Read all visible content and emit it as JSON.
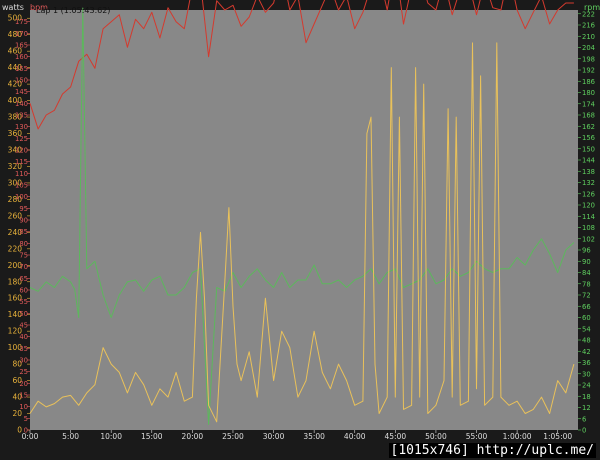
{
  "chart_data": {
    "type": "line",
    "title": "Lap 1 (1:05:43.62)",
    "x_ticks": [
      "0:00",
      "5:00",
      "10:00",
      "15:00",
      "20:00",
      "25:00",
      "30:00",
      "35:00",
      "40:00",
      "45:00",
      "50:00",
      "55:00",
      "1:00:00",
      "1:05:00"
    ],
    "xlim_minutes": [
      0,
      67.5
    ],
    "grid": false,
    "axes": [
      {
        "id": "watts",
        "label": "watts",
        "side": "left-outer",
        "color": "#e9b33b",
        "ylim": [
          0,
          510
        ],
        "ticks": [
          0,
          20,
          40,
          60,
          80,
          100,
          120,
          140,
          160,
          180,
          200,
          220,
          240,
          260,
          280,
          300,
          320,
          340,
          360,
          380,
          400,
          420,
          440,
          460,
          480,
          500
        ]
      },
      {
        "id": "bpm",
        "label": "bpm",
        "side": "left-inner",
        "color": "#e05a5a",
        "ylim": [
          0,
          180
        ],
        "ticks": [
          0,
          5,
          10,
          15,
          20,
          25,
          30,
          35,
          40,
          45,
          50,
          55,
          60,
          65,
          70,
          75,
          80,
          85,
          90,
          95,
          100,
          105,
          110,
          115,
          120,
          125,
          130,
          135,
          140,
          145,
          150,
          155,
          160,
          165,
          170,
          175
        ]
      },
      {
        "id": "rpm",
        "label": "rpm",
        "side": "right",
        "color": "#5fcf5f",
        "ylim": [
          0,
          224
        ],
        "ticks": [
          0,
          6,
          12,
          18,
          24,
          30,
          36,
          42,
          48,
          54,
          60,
          66,
          72,
          78,
          84,
          90,
          96,
          102,
          108,
          114,
          120,
          126,
          132,
          138,
          144,
          150,
          156,
          162,
          168,
          174,
          180,
          186,
          192,
          198,
          204,
          210,
          216,
          222
        ]
      }
    ],
    "series": [
      {
        "axis": "bpm",
        "color": "#d43a2e",
        "x": [
          0,
          1,
          2,
          3,
          4,
          5,
          6,
          7,
          8,
          9,
          10,
          11,
          12,
          13,
          14,
          15,
          16,
          17,
          18,
          19,
          20,
          21,
          22,
          23,
          24,
          25,
          26,
          27,
          28,
          29,
          30,
          31,
          32,
          33,
          34,
          35,
          36,
          37,
          38,
          39,
          40,
          41,
          42,
          43,
          44,
          45,
          46,
          47,
          48,
          49,
          50,
          51,
          52,
          53,
          54,
          55,
          56,
          57,
          58,
          59,
          60,
          61,
          62,
          63,
          64,
          65,
          66,
          67
        ],
        "y": [
          140,
          129,
          135,
          137,
          144,
          147,
          158,
          161,
          155,
          172,
          175,
          178,
          164,
          176,
          172,
          179,
          168,
          181,
          175,
          172,
          190,
          192,
          160,
          184,
          180,
          182,
          173,
          177,
          186,
          179,
          183,
          197,
          180,
          186,
          166,
          174,
          182,
          190,
          180,
          186,
          172,
          179,
          190,
          195,
          180,
          200,
          174,
          190,
          196,
          183,
          180,
          193,
          178,
          189,
          192,
          178,
          192,
          181,
          180,
          196,
          180,
          172,
          179,
          186,
          174,
          180,
          183,
          183
        ]
      },
      {
        "axis": "rpm",
        "color": "#5cb85c",
        "x": [
          0,
          1,
          2,
          3,
          4,
          5,
          5.5,
          6,
          6.5,
          7,
          8,
          9,
          10,
          11,
          12,
          13,
          14,
          15,
          16,
          17,
          18,
          19,
          20,
          21,
          22,
          23,
          24,
          25,
          26,
          27,
          28,
          29,
          30,
          31,
          32,
          33,
          34,
          35,
          36,
          37,
          38,
          39,
          40,
          41,
          42,
          43,
          44,
          45,
          46,
          47,
          48,
          49,
          50,
          51,
          52,
          53,
          54,
          55,
          56,
          57,
          58,
          59,
          60,
          61,
          62,
          63,
          64,
          65,
          66,
          67
        ],
        "y": [
          76,
          74,
          79,
          76,
          82,
          79,
          75,
          60,
          225,
          86,
          90,
          72,
          60,
          72,
          79,
          80,
          74,
          80,
          82,
          72,
          72,
          76,
          84,
          86,
          3,
          76,
          74,
          84,
          76,
          82,
          86,
          80,
          76,
          84,
          76,
          80,
          80,
          88,
          78,
          78,
          80,
          76,
          80,
          82,
          86,
          78,
          84,
          86,
          76,
          78,
          80,
          86,
          78,
          80,
          86,
          82,
          84,
          90,
          86,
          84,
          86,
          86,
          92,
          88,
          96,
          102,
          94,
          84,
          96,
          100
        ]
      },
      {
        "axis": "watts",
        "color": "#e9c15a",
        "x": [
          0,
          1,
          2,
          3,
          4,
          5,
          6,
          7,
          8,
          9,
          10,
          11,
          12,
          13,
          14,
          15,
          16,
          17,
          18,
          19,
          20,
          20.5,
          21,
          21.5,
          22,
          23,
          24,
          24.5,
          25,
          25.5,
          26,
          27,
          28,
          29,
          30,
          31,
          32,
          33,
          34,
          35,
          36,
          37,
          38,
          39,
          40,
          41,
          41.5,
          42,
          42.5,
          43,
          44,
          44.5,
          45,
          45.5,
          46,
          47,
          47.5,
          48,
          48.5,
          49,
          50,
          51,
          51.5,
          52,
          52.5,
          53,
          54,
          54.5,
          55,
          55.5,
          56,
          57,
          57.5,
          58,
          59,
          60,
          61,
          62,
          63,
          64,
          65,
          66,
          67
        ],
        "y": [
          20,
          35,
          28,
          32,
          40,
          42,
          30,
          45,
          55,
          100,
          80,
          70,
          45,
          70,
          55,
          30,
          50,
          40,
          70,
          35,
          40,
          160,
          240,
          160,
          30,
          10,
          180,
          270,
          150,
          80,
          60,
          95,
          40,
          160,
          60,
          120,
          100,
          40,
          60,
          120,
          70,
          50,
          80,
          60,
          30,
          35,
          360,
          380,
          80,
          20,
          40,
          440,
          40,
          380,
          25,
          30,
          440,
          40,
          420,
          20,
          30,
          60,
          390,
          40,
          380,
          30,
          35,
          470,
          50,
          430,
          30,
          40,
          470,
          40,
          30,
          35,
          20,
          25,
          40,
          20,
          60,
          45,
          80
        ]
      }
    ]
  },
  "caption": "[1015x746] http://uplc.me/"
}
